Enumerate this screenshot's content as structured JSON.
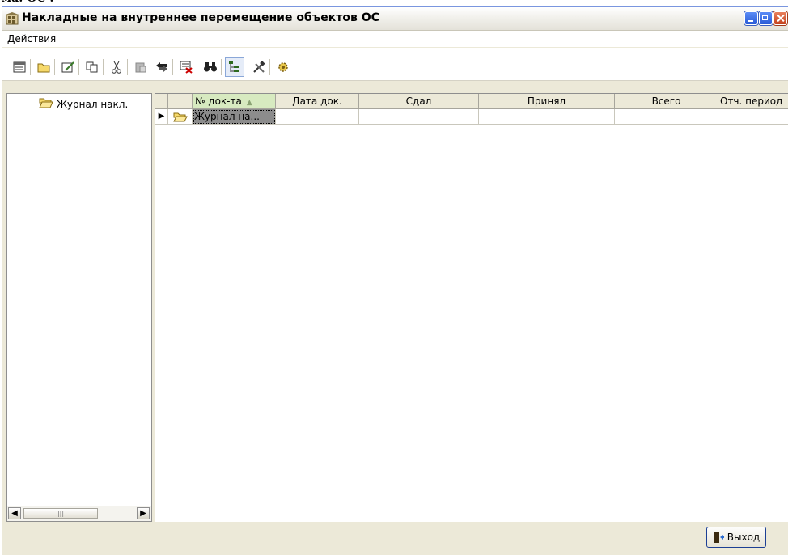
{
  "window": {
    "title": "Накладные на внутреннее перемещение объектов ОС"
  },
  "menu": {
    "items": [
      "Действия"
    ]
  },
  "toolbar": {
    "buttons": [
      {
        "name": "new-document-icon",
        "glyph": "▤"
      },
      {
        "name": "new-folder-icon",
        "glyph": "📁"
      },
      {
        "name": "edit-icon",
        "glyph": "✎"
      },
      {
        "name": "copy-icon",
        "glyph": "⎘"
      },
      {
        "name": "cut-icon",
        "glyph": "✂"
      },
      {
        "name": "paste-icon",
        "glyph": "📋"
      },
      {
        "name": "move-icon",
        "glyph": "⇆"
      },
      {
        "name": "delete-mark-icon",
        "glyph": "☒"
      },
      {
        "name": "find-icon",
        "glyph": "🔍"
      },
      {
        "name": "tree-view-icon",
        "glyph": "☰"
      },
      {
        "name": "tools-icon",
        "glyph": "⚒"
      },
      {
        "name": "settings-icon",
        "glyph": "✱"
      }
    ]
  },
  "tree": {
    "root_label": "Журнал накл."
  },
  "grid": {
    "columns": [
      "№ док-та",
      "Дата док.",
      "Сдал",
      "Принял",
      "Всего",
      "Отч. период"
    ],
    "sort_indicator": "▲",
    "rows": [
      {
        "indicator": "▶",
        "doc_no": "Журнал на...",
        "date": "",
        "gave": "",
        "received": "",
        "total": "",
        "period": ""
      }
    ]
  },
  "exit_button": {
    "label": "Выход"
  },
  "colors": {
    "window_bg": "#ece9d8",
    "sorted_header": "#d7eac0",
    "selected_cell": "#8c8c8c",
    "window_border": "#7a96df"
  }
}
